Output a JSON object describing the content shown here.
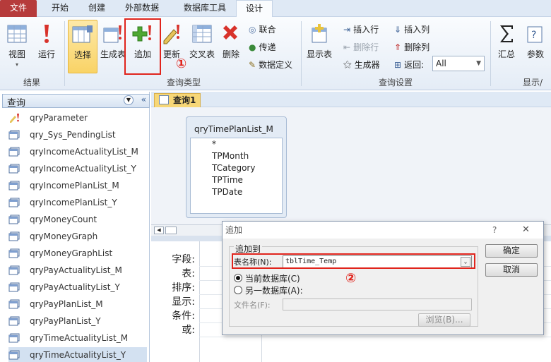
{
  "tabs": [
    "文件",
    "开始",
    "创建",
    "外部数据",
    "数据库工具",
    "设计"
  ],
  "ribbon": {
    "results": {
      "view": "视图",
      "run": "运行",
      "group": "结果"
    },
    "query_type": {
      "select": "选择",
      "make_table": "生成表",
      "append": "追加",
      "update": "更新",
      "crosstab": "交叉表",
      "delete": "删除",
      "union": "联合",
      "pass_through": "传递",
      "data_definition": "数据定义",
      "group": "查询类型"
    },
    "setup": {
      "show_table": "显示表",
      "insert_rows": "插入行",
      "delete_rows": "删除行",
      "builder": "生成器",
      "insert_cols": "插入列",
      "delete_cols": "删除列",
      "return_label": "返回:",
      "return_value": "All",
      "group": "查询设置"
    },
    "show_hide": {
      "totals": "汇总",
      "params": "参数",
      "group": "显示/"
    }
  },
  "annotations": {
    "one": "①",
    "two": "②"
  },
  "nav": {
    "header": "查询",
    "items": [
      "qryParameter",
      "qry_Sys_PendingList",
      "qryIncomeActualityList_M",
      "qryIncomeActualityList_Y",
      "qryIncomePlanList_M",
      "qryIncomePlanList_Y",
      "qryMoneyCount",
      "qryMoneyGraph",
      "qryMoneyGraphList",
      "qryPayActualityList_M",
      "qryPayActualityList_Y",
      "qryPayPlanList_M",
      "qryPayPlanList_Y",
      "qryTimeActualityList_M",
      "qryTimeActualityList_Y"
    ]
  },
  "doc": {
    "tab": "查询1",
    "table_name": "qryTimePlanList_M",
    "fields": [
      "*",
      "TPMonth",
      "TCategory",
      "TPTime",
      "TPDate"
    ],
    "grid_rows": [
      "字段:",
      "表:",
      "排序:",
      "显示:",
      "条件:",
      "或:"
    ]
  },
  "dialog": {
    "title": "追加",
    "help": "?",
    "close": "✕",
    "group_label": "追加到",
    "table_label": "表名称(N):",
    "table_value": "tblTime_Temp",
    "current_db": "当前数据库(C)",
    "other_db": "另一数据库(A):",
    "filename_label": "文件名(F):",
    "browse": "浏览(B)...",
    "ok": "确定",
    "cancel": "取消"
  }
}
